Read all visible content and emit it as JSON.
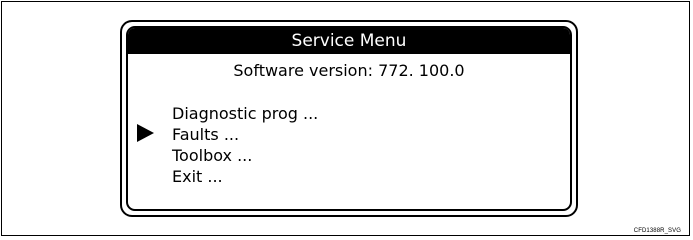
{
  "screen": {
    "title": "Service Menu",
    "software_version": "Software version: 772. 100.0"
  },
  "menu": {
    "items": [
      {
        "label": "Diagnostic prog ..."
      },
      {
        "label": "Faults ..."
      },
      {
        "label": "Toolbox ..."
      },
      {
        "label": "Exit ..."
      }
    ],
    "selected_index": 1,
    "pointer_icon": "triangle-right-icon"
  },
  "figure": {
    "reference_code": "CFD1388R_SVG"
  }
}
